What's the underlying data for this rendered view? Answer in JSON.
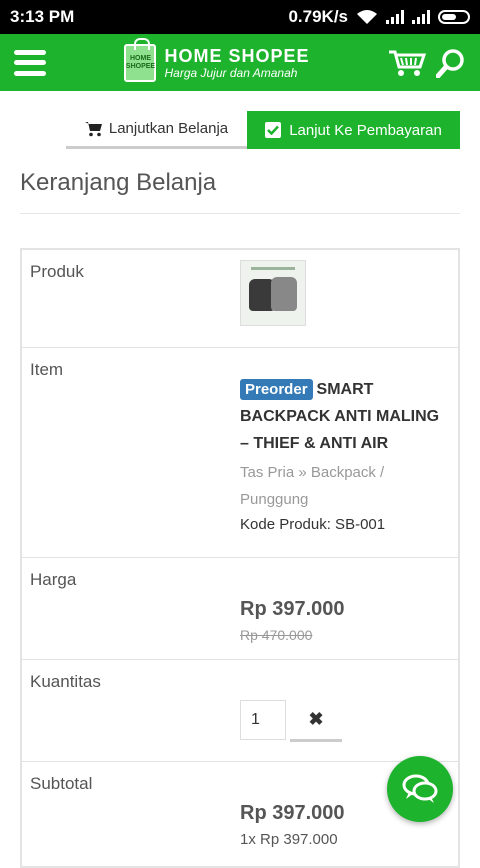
{
  "statusbar": {
    "time": "3:13 PM",
    "speed": "0.79K/s"
  },
  "header": {
    "brand_name": "HOME SHOPEE",
    "tagline": "Harga Jujur dan Amanah",
    "bag_text": "HOME SHOPEE"
  },
  "actions": {
    "continue_label": "Lanjutkan Belanja",
    "checkout_label": "Lanjut Ke Pembayaran"
  },
  "page": {
    "title": "Keranjang Belanja"
  },
  "cart": {
    "labels": {
      "product": "Produk",
      "item": "Item",
      "price": "Harga",
      "qty": "Kuantitas",
      "subtotal": "Subtotal"
    },
    "item": {
      "badge": "Preorder",
      "name": "SMART BACKPACK ANTI MALING – THIEF & ANTI AIR",
      "category": "Tas Pria » Backpack / Punggung",
      "code": "Kode Produk: SB-001"
    },
    "price": "Rp 397.000",
    "old_price": "Rp 470.000",
    "quantity": "1",
    "remove_symbol": "✖",
    "subtotal": "Rp 397.000",
    "subtotal_detail": "1x Rp 397.000"
  },
  "colors": {
    "accent": "#1db32d",
    "badge": "#337ab7"
  }
}
